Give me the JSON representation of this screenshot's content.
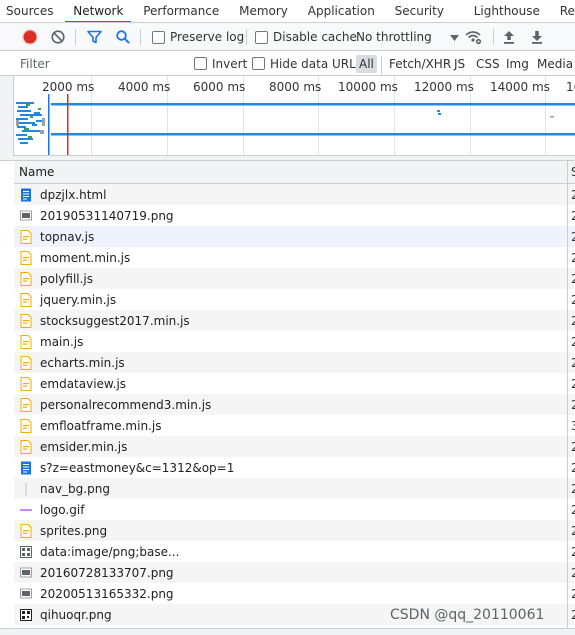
{
  "tabs": [
    "Sources",
    "Network",
    "Performance",
    "Memory",
    "Application",
    "Security",
    "Lighthouse",
    "Recorder"
  ],
  "toolbar": {
    "preserve_log": "Preserve log",
    "disable_cache": "Disable cache",
    "throttling": "No throttling"
  },
  "filterbar": {
    "placeholder": "Filter",
    "invert": "Invert",
    "hide_data_urls": "Hide data URLs",
    "types": [
      "All",
      "Fetch/XHR",
      "JS",
      "CSS",
      "Img",
      "Media"
    ]
  },
  "overview": {
    "ticks": [
      "2000 ms",
      "4000 ms",
      "6000 ms",
      "8000 ms",
      "10000 ms",
      "12000 ms",
      "14000 ms",
      "16"
    ]
  },
  "table": {
    "header_name": "Name",
    "rows": [
      {
        "name": "dpzjlx.html",
        "icon": "document-icon",
        "cut": "2"
      },
      {
        "name": "20190531140719.png",
        "icon": "image-icon",
        "cut": "2"
      },
      {
        "name": "topnav.js",
        "icon": "script-icon",
        "cut": "2"
      },
      {
        "name": "moment.min.js",
        "icon": "script-icon",
        "cut": "2"
      },
      {
        "name": "polyfill.js",
        "icon": "script-icon",
        "cut": "2"
      },
      {
        "name": "jquery.min.js",
        "icon": "script-icon",
        "cut": "2"
      },
      {
        "name": "stocksuggest2017.min.js",
        "icon": "script-icon",
        "cut": "2"
      },
      {
        "name": "main.js",
        "icon": "script-icon",
        "cut": "2"
      },
      {
        "name": "echarts.min.js",
        "icon": "script-icon",
        "cut": "2"
      },
      {
        "name": "emdataview.js",
        "icon": "script-icon",
        "cut": "2"
      },
      {
        "name": "personalrecommend3.min.js",
        "icon": "script-icon",
        "cut": "2"
      },
      {
        "name": "emfloatframe.min.js",
        "icon": "script-icon",
        "cut": "3"
      },
      {
        "name": "emsider.min.js",
        "icon": "script-icon",
        "cut": "2"
      },
      {
        "name": "s?z=eastmoney&c=1312&op=1",
        "icon": "document-icon",
        "cut": "2"
      },
      {
        "name": "nav_bg.png",
        "icon": "image-thin-icon",
        "cut": "2"
      },
      {
        "name": "logo.gif",
        "icon": "image-line-icon",
        "cut": "2"
      },
      {
        "name": "sprites.png",
        "icon": "script-icon",
        "cut": "2"
      },
      {
        "name": "data:image/png;base...",
        "icon": "pattern-icon",
        "cut": "2"
      },
      {
        "name": "20160728133707.png",
        "icon": "image-icon",
        "cut": "2"
      },
      {
        "name": "20200513165332.png",
        "icon": "image-icon",
        "cut": "2"
      },
      {
        "name": "qihuoqr.png",
        "icon": "qr-icon",
        "cut": "2"
      }
    ]
  },
  "watermark": "CSDN @qq_20110061",
  "colors": {
    "accent": "#1a73e8",
    "record_red": "#d93025",
    "script_icon": "#f9ab00",
    "doc_icon": "#1a73e8",
    "timeline_blue": "#1e88e5",
    "load_red": "#d93025"
  }
}
